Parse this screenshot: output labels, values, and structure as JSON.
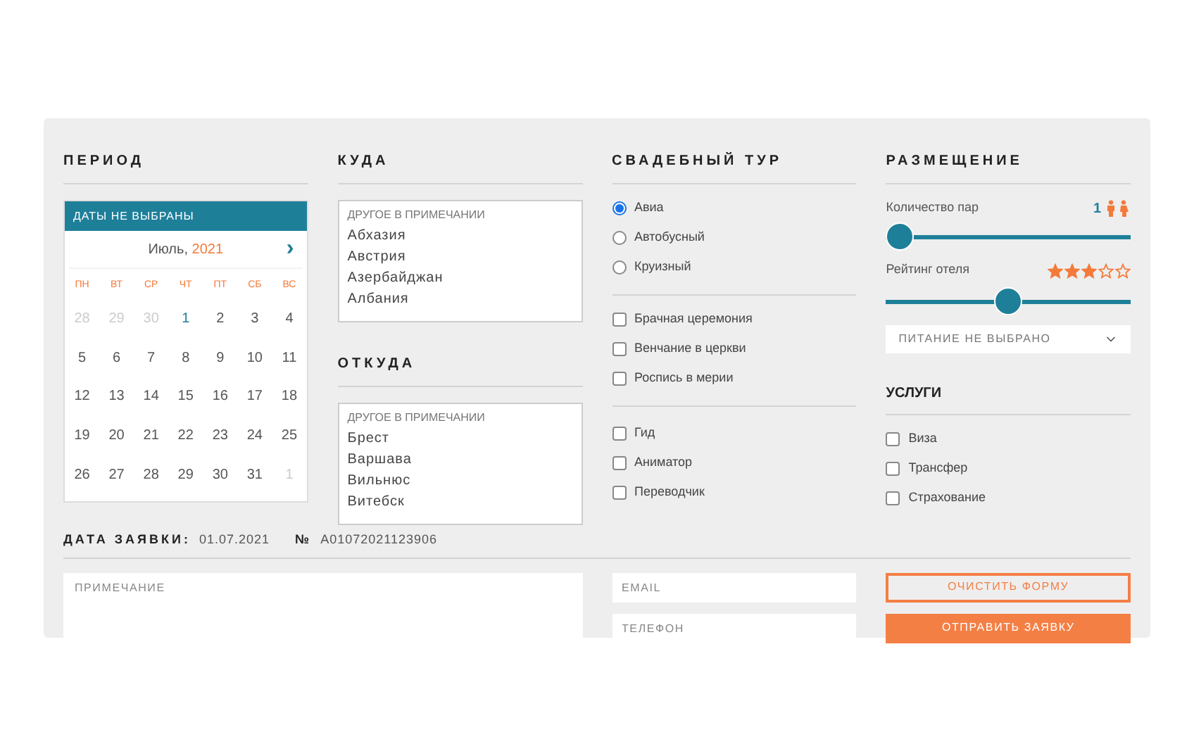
{
  "period": {
    "title": "ПЕРИОД",
    "banner": "ДАТЫ НЕ ВЫБРАНЫ",
    "month": "Июль,",
    "year": "2021",
    "next": "›",
    "weekdays": [
      "ПН",
      "ВТ",
      "СР",
      "ЧТ",
      "ПТ",
      "СБ",
      "ВС"
    ],
    "weeks": [
      [
        {
          "text": "28",
          "kind": "other"
        },
        {
          "text": "29",
          "kind": "other"
        },
        {
          "text": "30",
          "kind": "other"
        },
        {
          "text": "1",
          "kind": "today"
        },
        {
          "text": "2",
          "kind": "day"
        },
        {
          "text": "3",
          "kind": "day"
        },
        {
          "text": "4",
          "kind": "day"
        }
      ],
      [
        {
          "text": "5",
          "kind": "day"
        },
        {
          "text": "6",
          "kind": "day"
        },
        {
          "text": "7",
          "kind": "day"
        },
        {
          "text": "8",
          "kind": "day"
        },
        {
          "text": "9",
          "kind": "day"
        },
        {
          "text": "10",
          "kind": "day"
        },
        {
          "text": "11",
          "kind": "day"
        }
      ],
      [
        {
          "text": "12",
          "kind": "day"
        },
        {
          "text": "13",
          "kind": "day"
        },
        {
          "text": "14",
          "kind": "day"
        },
        {
          "text": "15",
          "kind": "day"
        },
        {
          "text": "16",
          "kind": "day"
        },
        {
          "text": "17",
          "kind": "day"
        },
        {
          "text": "18",
          "kind": "day"
        }
      ],
      [
        {
          "text": "19",
          "kind": "day"
        },
        {
          "text": "20",
          "kind": "day"
        },
        {
          "text": "21",
          "kind": "day"
        },
        {
          "text": "22",
          "kind": "day"
        },
        {
          "text": "23",
          "kind": "day"
        },
        {
          "text": "24",
          "kind": "day"
        },
        {
          "text": "25",
          "kind": "day"
        }
      ],
      [
        {
          "text": "26",
          "kind": "day"
        },
        {
          "text": "27",
          "kind": "day"
        },
        {
          "text": "28",
          "kind": "day"
        },
        {
          "text": "29",
          "kind": "day"
        },
        {
          "text": "30",
          "kind": "day"
        },
        {
          "text": "31",
          "kind": "day"
        },
        {
          "text": "1",
          "kind": "other"
        }
      ]
    ]
  },
  "destination": {
    "title": "КУДА",
    "options": [
      {
        "text": "ДРУГОЕ В ПРИМЕЧАНИИ",
        "kind": "hint"
      },
      {
        "text": "Абхазия",
        "kind": "option"
      },
      {
        "text": "Австрия",
        "kind": "option"
      },
      {
        "text": "Азербайджан",
        "kind": "option"
      },
      {
        "text": "Албания",
        "kind": "option"
      }
    ]
  },
  "origin": {
    "title": "ОТКУДА",
    "options": [
      {
        "text": "ДРУГОЕ В ПРИМЕЧАНИИ",
        "kind": "hint"
      },
      {
        "text": "Брест",
        "kind": "option"
      },
      {
        "text": "Варшава",
        "kind": "option"
      },
      {
        "text": "Вильнюс",
        "kind": "option"
      },
      {
        "text": "Витебск",
        "kind": "option"
      }
    ]
  },
  "wedding_tour": {
    "title": "СВАДЕБНЫЙ ТУР",
    "transport": [
      {
        "label": "Авиа",
        "selected": true
      },
      {
        "label": "Автобусный",
        "selected": false
      },
      {
        "label": "Круизный",
        "selected": false
      }
    ],
    "ceremony": [
      {
        "label": "Брачная церемония",
        "checked": false
      },
      {
        "label": "Венчание в церкви",
        "checked": false
      },
      {
        "label": "Роспись в мерии",
        "checked": false
      }
    ],
    "extras": [
      {
        "label": "Гид",
        "checked": false
      },
      {
        "label": "Аниматор",
        "checked": false
      },
      {
        "label": "Переводчик",
        "checked": false
      }
    ]
  },
  "accommodation": {
    "title": "РАЗМЕЩЕНИЕ",
    "pairs": {
      "label": "Количество пар",
      "value": "1",
      "level": 0
    },
    "rating": {
      "label": "Рейтинг отеля",
      "stars": 3,
      "level": 0.5
    },
    "meals": {
      "value": "ПИТАНИЕ НЕ ВЫБРАНО"
    }
  },
  "services": {
    "title": "УСЛУГИ",
    "items": [
      {
        "label": "Виза",
        "checked": false
      },
      {
        "label": "Трансфер",
        "checked": false
      },
      {
        "label": "Страхование",
        "checked": false
      }
    ]
  },
  "request": {
    "date_label": "ДАТА ЗАЯВКИ:",
    "date": "01.07.2021",
    "number_sign": "№",
    "number": "A01072021123906"
  },
  "note": {
    "placeholder": "ПРИМЕЧАНИЕ"
  },
  "email": {
    "placeholder": "EMAIL"
  },
  "phone": {
    "placeholder": "ТЕЛЕФОН"
  },
  "buttons": [
    {
      "label": "ОЧИСТИТЬ ФОРМУ",
      "kind": "outline"
    },
    {
      "label": "ОТПРАВИТЬ ЗАЯВКУ",
      "kind": "filled"
    }
  ]
}
